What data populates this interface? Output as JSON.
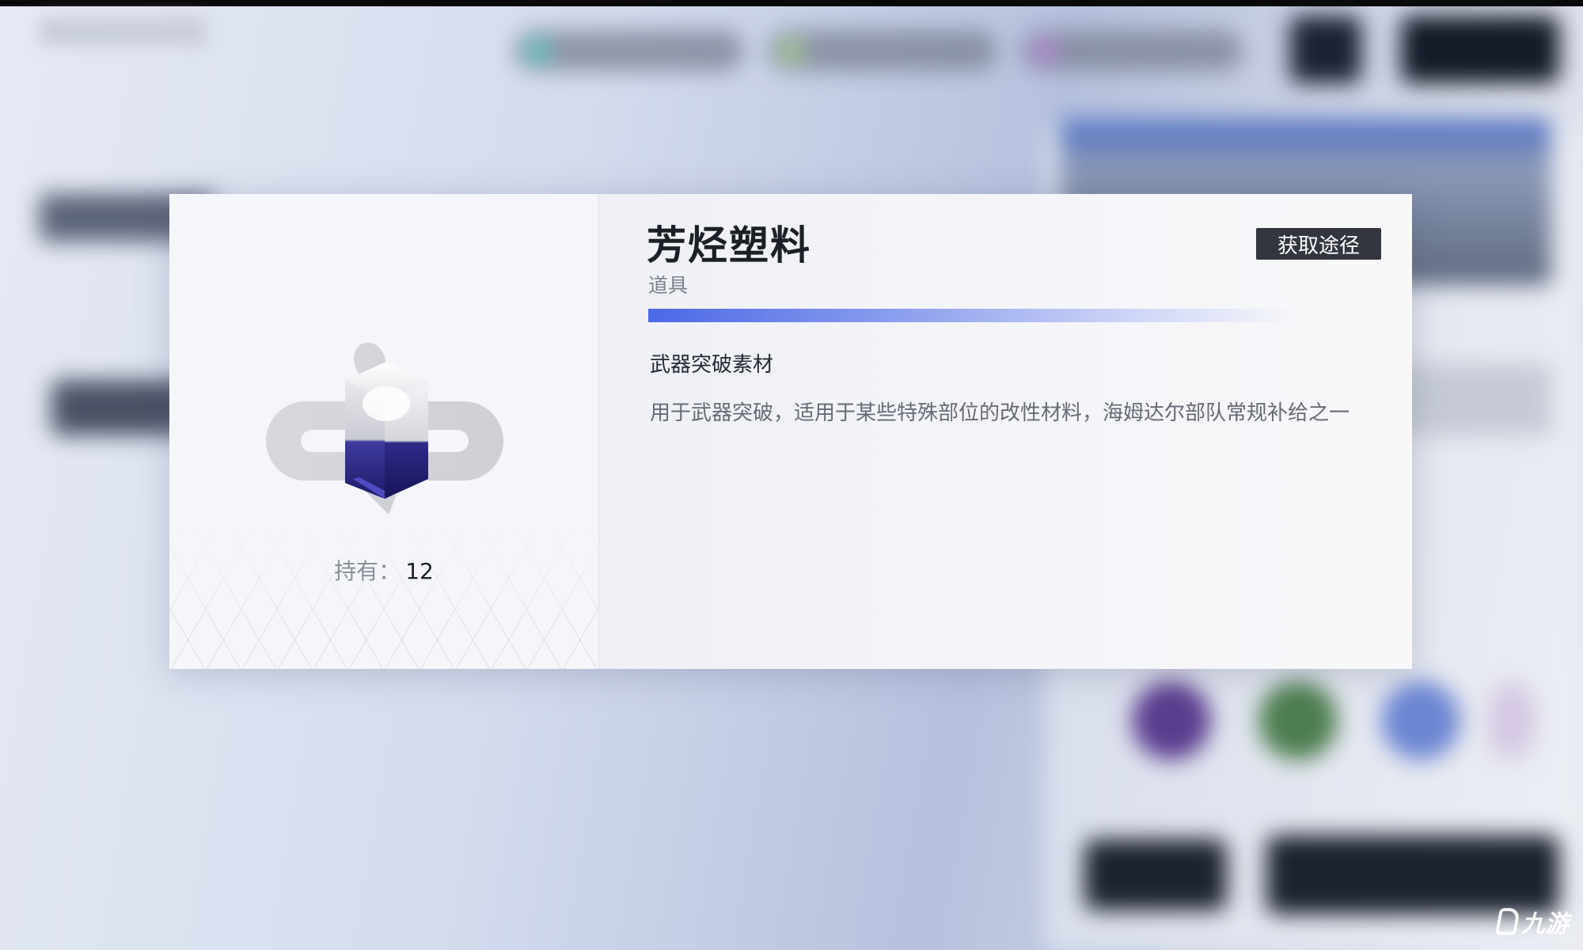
{
  "item": {
    "name": "芳烃塑料",
    "type": "道具",
    "category": "武器突破素材",
    "description": "用于武器突破，适用于某些特殊部位的改性材料，海姆达尔部队常规补给之一",
    "holdings_label": "持有：",
    "holdings_value": "12",
    "icon": "translucent-cube-material-icon"
  },
  "actions": {
    "obtain_label": "获取途径"
  },
  "colors": {
    "accent": "#4b68e6",
    "button_bg": "#33363f",
    "cube_liquid": "#2f2a8c"
  },
  "watermark": {
    "text": "九游"
  }
}
